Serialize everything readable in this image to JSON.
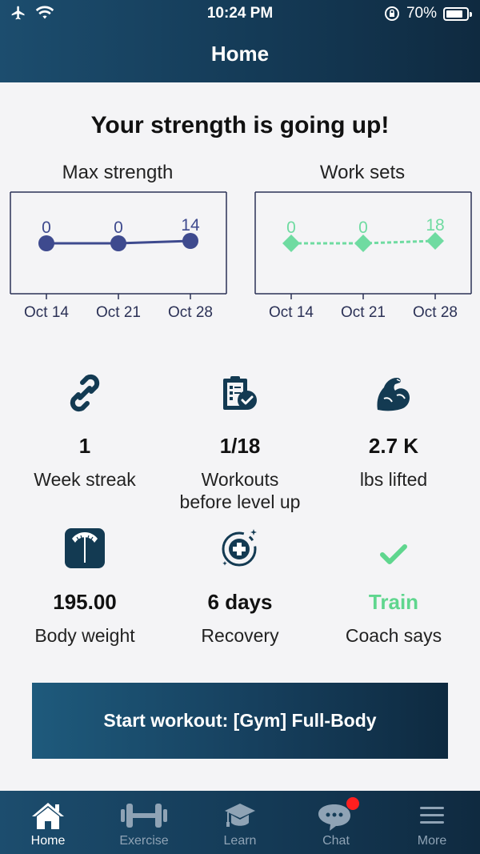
{
  "status_bar": {
    "time": "10:24 PM",
    "battery": "70%",
    "battery_level": 0.7
  },
  "header": {
    "title": "Home"
  },
  "headline": "Your strength is going up!",
  "charts": {
    "max_strength": {
      "title": "Max strength",
      "color": "#3e4a8e",
      "marker": "circle",
      "line_style": "solid"
    },
    "work_sets": {
      "title": "Work sets",
      "color": "#6fdba1",
      "marker": "diamond",
      "line_style": "dashed"
    }
  },
  "chart_data": [
    {
      "type": "line",
      "title": "Max strength",
      "categories": [
        "Oct 14",
        "Oct 21",
        "Oct 28"
      ],
      "series": [
        {
          "values": [
            0,
            0,
            14
          ]
        }
      ],
      "data_labels": true,
      "legend": "none"
    },
    {
      "type": "line",
      "title": "Work sets",
      "categories": [
        "Oct 14",
        "Oct 21",
        "Oct 28"
      ],
      "series": [
        {
          "values": [
            0,
            0,
            18
          ]
        }
      ],
      "data_labels": true,
      "legend": "none"
    }
  ],
  "stats": {
    "week_streak": {
      "value": "1",
      "label": "Week streak",
      "icon": "link-icon"
    },
    "workouts": {
      "value": "1/18",
      "label_line1": "Workouts",
      "label_line2": "before level up",
      "icon": "clipboard-check-icon"
    },
    "lbs_lifted": {
      "value": "2.7 K",
      "label": "lbs lifted",
      "icon": "flexed-arm-icon"
    },
    "body_weight": {
      "value": "195.00",
      "label": "Body weight",
      "icon": "scale-icon"
    },
    "recovery": {
      "value": "6 days",
      "label": "Recovery",
      "icon": "recovery-plus-icon"
    },
    "coach": {
      "value": "Train",
      "label": "Coach says",
      "icon": "checkmark-icon",
      "accent": "#5fd68e"
    }
  },
  "start_button": {
    "label": "Start workout: [Gym] Full-Body"
  },
  "tabbar": {
    "tabs": [
      {
        "label": "Home",
        "icon": "home-icon",
        "active": true
      },
      {
        "label": "Exercise",
        "icon": "dumbbell-icon",
        "active": false
      },
      {
        "label": "Learn",
        "icon": "graduation-cap-icon",
        "active": false
      },
      {
        "label": "Chat",
        "icon": "chat-bubbles-icon",
        "active": false,
        "badge": true
      },
      {
        "label": "More",
        "icon": "hamburger-menu-icon",
        "active": false
      }
    ]
  }
}
